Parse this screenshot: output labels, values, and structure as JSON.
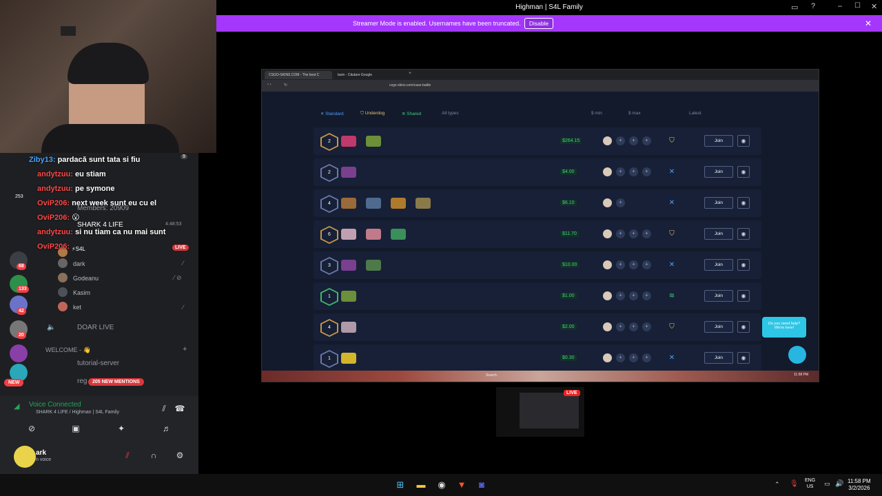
{
  "window": {
    "title": "Highman | S4L Family",
    "banner_text": "Streamer Mode is enabled. Usernames have been truncated.",
    "banner_button": "Disable"
  },
  "chat": {
    "messages": [
      {
        "user": "Ziby13:",
        "text": "pardacă sunt tata si fiu",
        "tier": ""
      },
      {
        "user": "andytzuu:",
        "text": "eu stiam",
        "tier": ""
      },
      {
        "user": "andytzuu:",
        "text": "pe symone",
        "tier": ""
      },
      {
        "user": "OviP206:",
        "text": "next week sunt eu cu el",
        "tier": "253"
      },
      {
        "user": "OviP206:",
        "text": "😮",
        "tier": ""
      },
      {
        "user": "andytzuu:",
        "text": "si nu tiam ca nu mai sunt",
        "tier": ""
      },
      {
        "user": "OviP206:",
        "text": "",
        "tier": ""
      }
    ],
    "badge_count": "9"
  },
  "discord": {
    "members_label": "Members: 20909",
    "voice_channel": "SHARK 4 LIFE",
    "voice_timer": "4:48:53",
    "live_user": "⚡S4L",
    "live_badge": "LIVE",
    "users": [
      "dark",
      "Godeanu",
      "Kasim",
      "ket"
    ],
    "channel_doar": "DOAR LIVE",
    "category_welcome": "WELCOME - 👋",
    "channel_tutorial": "tutorial-server",
    "channel_reg": "reg",
    "mentions": "205 NEW MENTIONS",
    "new_badge": "NEW",
    "server_counts": [
      "68",
      "133",
      "42",
      "20"
    ],
    "voice_connected": "Voice Connected",
    "voice_location": "SHARK 4 LIFE / Highman | S4L Family",
    "self_name": "ark",
    "self_status": "n voice"
  },
  "browser": {
    "tabs": [
      "CSGO-SKINS.COM - The best C",
      "lavin - Căutare Google"
    ],
    "url": "csgo-skins.com/case-battle",
    "filters": {
      "standard": "Standard",
      "underdog": "Underdog",
      "shared": "Shared",
      "all_types": "All types",
      "min": "$ min",
      "max": "$ max",
      "sort": "Latest"
    },
    "rows": [
      {
        "players": "2",
        "price": "$264.15",
        "join": "Join"
      },
      {
        "players": "2",
        "price": "$4.00",
        "join": "Join"
      },
      {
        "players": "4",
        "price": "$6.10",
        "join": "Join"
      },
      {
        "players": "6",
        "price": "$11.70",
        "join": "Join"
      },
      {
        "players": "3",
        "price": "$10.00",
        "join": "Join"
      },
      {
        "players": "1",
        "price": "$1.00",
        "join": "Join"
      },
      {
        "players": "4",
        "price": "$2.00",
        "join": "Join"
      },
      {
        "players": "1",
        "price": "$0.30",
        "join": "Join"
      }
    ],
    "help_text_1": "Do you need help?",
    "help_text_2": "We're here!",
    "inner_search": "Search",
    "inner_clock": "11:58 PM"
  },
  "preview": {
    "live": "LIVE"
  },
  "taskbar": {
    "lang_1": "ENG",
    "lang_2": "US",
    "time": "11:58 PM",
    "date": "3/2/2026"
  },
  "colors": {
    "banner": "#a537fd",
    "discord_bg": "#1e1f22",
    "site_bg": "#131a2b",
    "price_green": "#3fd07a",
    "live_red": "#e22"
  }
}
